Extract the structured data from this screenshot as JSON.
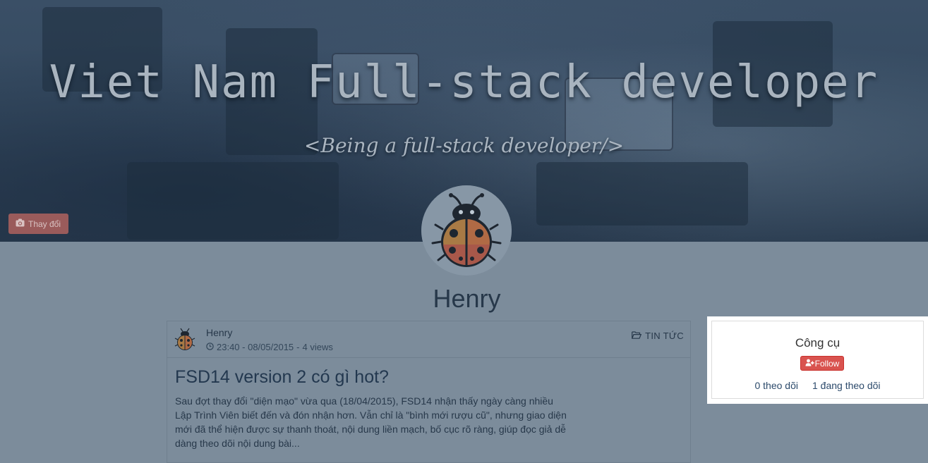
{
  "cover": {
    "title": "Viet Nam Full-stack developer",
    "subtitle": "<Being a full-stack developer/>",
    "change_button_label": "Thay đổi",
    "change_button_icon": "camera-icon"
  },
  "profile": {
    "name": "Henry",
    "avatar_icon": "ladybug-icon"
  },
  "post": {
    "author": "Henry",
    "time": "23:40 - 08/05/2015",
    "separator": "-",
    "views": "4 views",
    "category": "TIN TỨC",
    "title": "FSD14 version 2 có gì hot?",
    "excerpt": "Sau đợt thay đổi \"diện mạo\" vừa qua (18/04/2015), FSD14 nhận thấy ngày càng nhiều Lập Trình Viên biết đến và đón nhận hơn. Vẫn chỉ là \"bình mới rượu cũ\", nhưng giao diện mới đã thể hiện được sự thanh thoát, nội dung liền mạch, bố cục rõ ràng, giúp đọc giả dễ dàng theo dõi nội dung bài..."
  },
  "tools": {
    "title": "Công cụ",
    "follow_label": "Follow",
    "followers": "0 theo dõi",
    "following": "1 đang theo dõi"
  },
  "colors": {
    "follow_button": "#d9534f",
    "change_button": "#9a5b5b",
    "overlay": "#7c8c9b"
  }
}
